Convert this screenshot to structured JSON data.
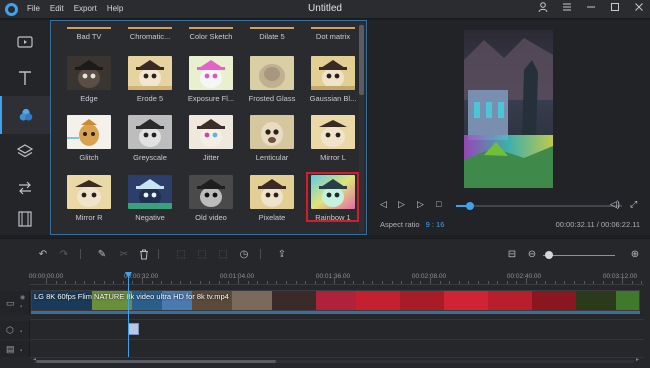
{
  "window": {
    "title": "Untitled",
    "menu": [
      "File",
      "Edit",
      "Export",
      "Help"
    ]
  },
  "rail": {
    "items": [
      "media-icon",
      "text-icon",
      "filters-icon",
      "overlay-icon",
      "transition-icon",
      "film-icon"
    ],
    "active": "filters-icon"
  },
  "filters": {
    "top_row": [
      "Bad TV",
      "Chromatic...",
      "Color Sketch",
      "Dilate 5",
      "Dot matrix"
    ],
    "grid": [
      [
        "Edge",
        "Erode 5",
        "Exposure Fl...",
        "Frosted Glass",
        "Gaussian Bl..."
      ],
      [
        "Glitch",
        "Greyscale",
        "Jitter",
        "Lenticular",
        "Mirror L"
      ],
      [
        "Mirror R",
        "Negative",
        "Old video",
        "Pixelate",
        "Rainbow 1"
      ]
    ],
    "selected": "Rainbow 1"
  },
  "preview": {
    "aspect_label": "Aspect ratio",
    "aspect_value": "9 : 16",
    "timecode": "00:00:32.11 / 00:06:22.11",
    "progress_fraction": 0.084
  },
  "timeline": {
    "ruler": [
      "00:00:00.00",
      "00:00:32.00",
      "00:01:04.00",
      "00:01:36.00",
      "00:02:08.00",
      "00:02:40.00",
      "00:03:12.00"
    ],
    "clip_title": "LG 8K 60fps Flim NATURE 8k video ultra HD for 8k tv.mp4",
    "zoom_fraction": 0.08
  },
  "colors": {
    "accent": "#3fa2ef",
    "selected_border": "#d11e2a",
    "panel_border": "#3a6f9c"
  }
}
